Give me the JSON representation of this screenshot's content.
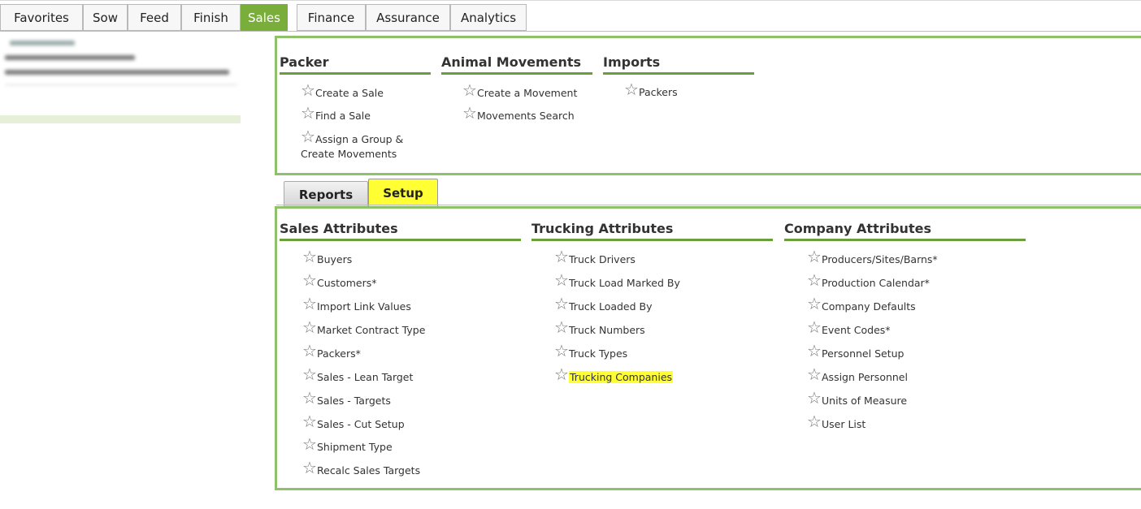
{
  "top_tabs": [
    {
      "label": "Favorites"
    },
    {
      "label": "Sow"
    },
    {
      "label": "Feed"
    },
    {
      "label": "Finish"
    },
    {
      "label": "Sales",
      "active": true
    },
    {
      "label": "Finance"
    },
    {
      "label": "Assurance"
    },
    {
      "label": "Analytics"
    }
  ],
  "company_panel": {
    "blurred": true
  },
  "top_panel": {
    "columns": [
      {
        "heading": "Packer",
        "items": [
          "Create a Sale",
          "Find a Sale",
          "Assign a Group &",
          "Create Movements"
        ]
      },
      {
        "heading": "Animal Movements",
        "items": [
          "Create a Movement",
          "Movements Search"
        ]
      },
      {
        "heading": "Imports",
        "items": [
          "Packers"
        ]
      }
    ]
  },
  "sub_tabs": [
    {
      "label": "Reports"
    },
    {
      "label": "Setup",
      "active": true
    }
  ],
  "setup_panel": {
    "columns": [
      {
        "heading": "Sales Attributes",
        "items": [
          "Buyers",
          "Customers*",
          "Import Link Values",
          "Market Contract Type",
          "Packers*",
          "Sales - Lean Target",
          "Sales - Targets",
          "Sales - Cut Setup",
          "Shipment Type",
          "Recalc Sales Targets"
        ]
      },
      {
        "heading": "Trucking Attributes",
        "items": [
          "Truck Drivers",
          "Truck Load Marked By",
          "Truck Loaded By",
          "Truck Numbers",
          "Truck Types",
          "Trucking Companies"
        ]
      },
      {
        "heading": "Company Attributes",
        "items": [
          "Producers/Sites/Barns*",
          "Production Calendar*",
          "Company Defaults",
          "Event Codes*",
          "Personnel Setup",
          "Assign Personnel",
          "Units of Measure",
          "User List"
        ]
      }
    ],
    "highlighted_item": "Trucking Companies"
  },
  "icons": {
    "favorite": "star-outline-icon"
  },
  "colors": {
    "accent_green": "#7aae3a",
    "panel_border": "#8dc26a",
    "highlight": "#ffff33"
  }
}
